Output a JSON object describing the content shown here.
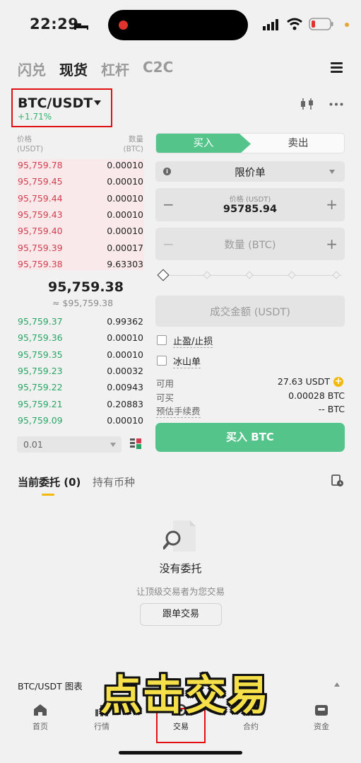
{
  "status": {
    "time": "22:29"
  },
  "tabs": [
    {
      "label": "闪兑",
      "active": false
    },
    {
      "label": "现货",
      "active": true
    },
    {
      "label": "杠杆",
      "active": false
    },
    {
      "label": "C2C",
      "active": false
    }
  ],
  "pair": {
    "name": "BTC/USDT",
    "change": "+1.71%"
  },
  "orderbook": {
    "price_header": [
      "价格",
      "(USDT)"
    ],
    "qty_header": [
      "数量",
      "(BTC)"
    ],
    "asks": [
      {
        "price": "95,759.78",
        "qty": "0.00010"
      },
      {
        "price": "95,759.45",
        "qty": "0.00010"
      },
      {
        "price": "95,759.44",
        "qty": "0.00010"
      },
      {
        "price": "95,759.43",
        "qty": "0.00010"
      },
      {
        "price": "95,759.40",
        "qty": "0.00010"
      },
      {
        "price": "95,759.39",
        "qty": "0.00017"
      },
      {
        "price": "95,759.38",
        "qty": "9.63303"
      }
    ],
    "mid_price": "95,759.38",
    "mid_usd": "≈ $95,759.38",
    "bids": [
      {
        "price": "95,759.37",
        "qty": "0.99362"
      },
      {
        "price": "95,759.36",
        "qty": "0.00010"
      },
      {
        "price": "95,759.35",
        "qty": "0.00010"
      },
      {
        "price": "95,759.23",
        "qty": "0.00032"
      },
      {
        "price": "95,759.22",
        "qty": "0.00943"
      },
      {
        "price": "95,759.21",
        "qty": "0.20883"
      },
      {
        "price": "95,759.09",
        "qty": "0.00010"
      }
    ],
    "depth": "0.01"
  },
  "form": {
    "buy": "买入",
    "sell": "卖出",
    "order_type": "限价单",
    "price_label": "价格 (USDT)",
    "price_value": "95785.94",
    "qty_placeholder": "数量 (BTC)",
    "total_placeholder": "成交金额 (USDT)",
    "tp_sl": "止盈/止损",
    "iceberg": "冰山单",
    "available_label": "可用",
    "available_value": "27.63 USDT",
    "can_buy_label": "可买",
    "can_buy_value": "0.00028 BTC",
    "fee_label": "预估手续费",
    "fee_value": "-- BTC",
    "submit": "买入 BTC"
  },
  "orders": {
    "tab_open": "当前委托 (0)",
    "tab_holdings": "持有币种",
    "empty_title": "没有委托",
    "empty_sub": "让顶级交易者为您交易",
    "copy_button": "跟单交易"
  },
  "chart_toggle": "BTC/USDT 图表",
  "caption": "点击交易",
  "nav": [
    {
      "label": "首页",
      "icon": "home-icon"
    },
    {
      "label": "行情",
      "icon": "market-icon"
    },
    {
      "label": "交易",
      "icon": "trade-icon"
    },
    {
      "label": "合约",
      "icon": "futures-icon"
    },
    {
      "label": "资金",
      "icon": "wallet-icon"
    }
  ]
}
